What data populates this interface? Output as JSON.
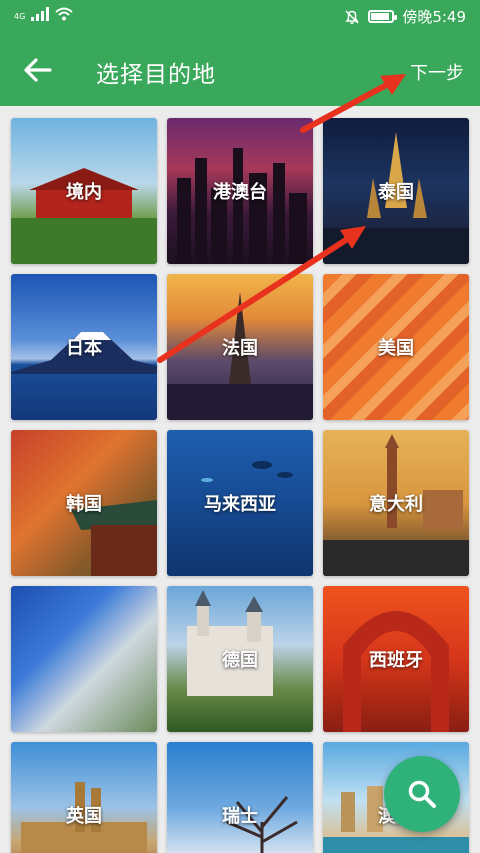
{
  "status_bar": {
    "network": "4G",
    "time": "傍晚5:49",
    "battery_level": 0.9
  },
  "app_bar": {
    "back_icon": "arrow-left-icon",
    "title": "选择目的地",
    "next_label": "下一步"
  },
  "destinations": [
    {
      "label": "境内"
    },
    {
      "label": "港澳台"
    },
    {
      "label": "泰国"
    },
    {
      "label": "日本"
    },
    {
      "label": "法国"
    },
    {
      "label": "美国"
    },
    {
      "label": "韩国"
    },
    {
      "label": "马来西亚"
    },
    {
      "label": "意大利"
    },
    {
      "label": ""
    },
    {
      "label": "德国"
    },
    {
      "label": "西班牙"
    },
    {
      "label": "英国"
    },
    {
      "label": "瑞士"
    },
    {
      "label": "澳大"
    }
  ],
  "fab": {
    "icon": "search-icon"
  },
  "colors": {
    "primary": "#3aa85a",
    "fab": "#2fb27a",
    "annotation_arrow": "#e8321e"
  }
}
